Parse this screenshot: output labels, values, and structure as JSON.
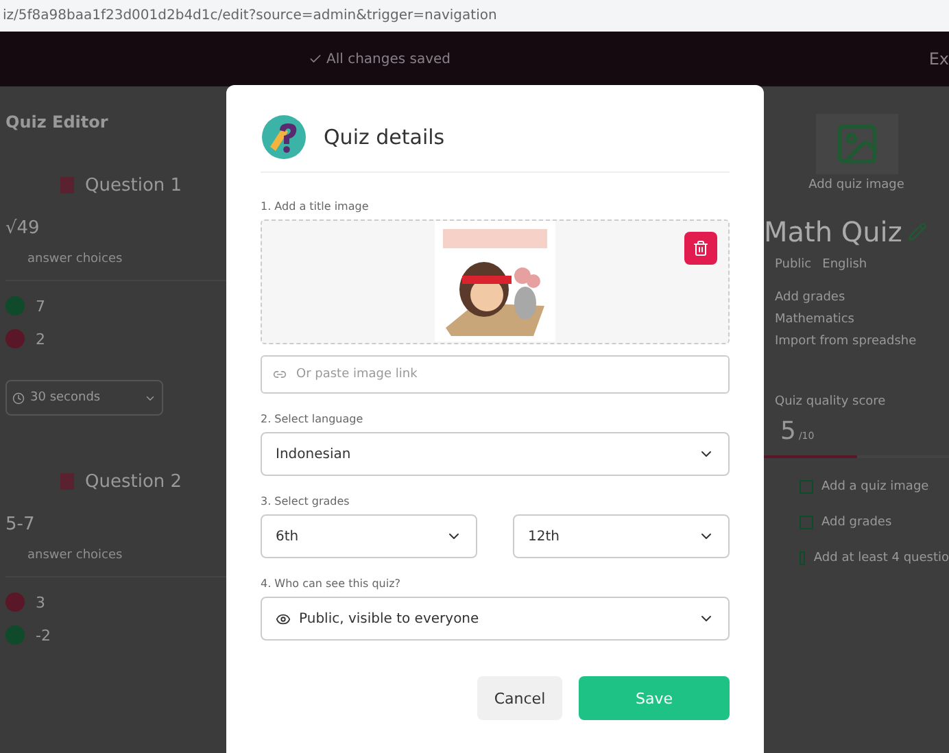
{
  "address_bar": {
    "url": "iz/5f8a98baa1f23d001d2b4d1c/edit?source=admin&trigger=navigation"
  },
  "header": {
    "save_status": "All changes saved",
    "action": "Ex"
  },
  "editor": {
    "title": "Quiz Editor",
    "questions": [
      {
        "label": "Question 1",
        "text": "√49",
        "choices_label": "answer choices",
        "answers": [
          {
            "text": "7",
            "correct": true
          },
          {
            "text": "2",
            "correct": false
          }
        ],
        "time": "30 seconds"
      },
      {
        "label": "Question 2",
        "text": "5-7",
        "choices_label": "answer choices",
        "answers": [
          {
            "text": "3",
            "correct": false
          },
          {
            "text": "-2",
            "correct": true
          }
        ]
      }
    ]
  },
  "quiz_panel": {
    "image_label": "Add quiz image",
    "title": "Math Quiz",
    "meta": [
      "Public",
      "English"
    ],
    "settings": [
      "Add grades",
      "Mathematics",
      "Import from spreadshe"
    ],
    "quality_label": "Quiz quality score",
    "score": "5",
    "score_max": "/10",
    "level": 0.5,
    "checklist": [
      {
        "text": "Add a quiz image",
        "done": false
      },
      {
        "text": "Add grades",
        "done": false
      },
      {
        "text": "Add at least 4 questio",
        "done": false
      }
    ]
  },
  "dialog": {
    "title": "Quiz details",
    "image_section": "1. Add a title image",
    "image_link_placeholder": "Or paste image link",
    "language_label": "2. Select language",
    "language": "Indonesian",
    "grades_label": "3. Select grades",
    "grade_from": "6th",
    "grade_to": "12th",
    "visibility_label": "4. Who can see this quiz?",
    "visibility": "Public, visible to everyone",
    "buttons": [
      {
        "label": "Cancel",
        "kind": "secondary"
      },
      {
        "label": "Save",
        "kind": "primary"
      }
    ]
  }
}
